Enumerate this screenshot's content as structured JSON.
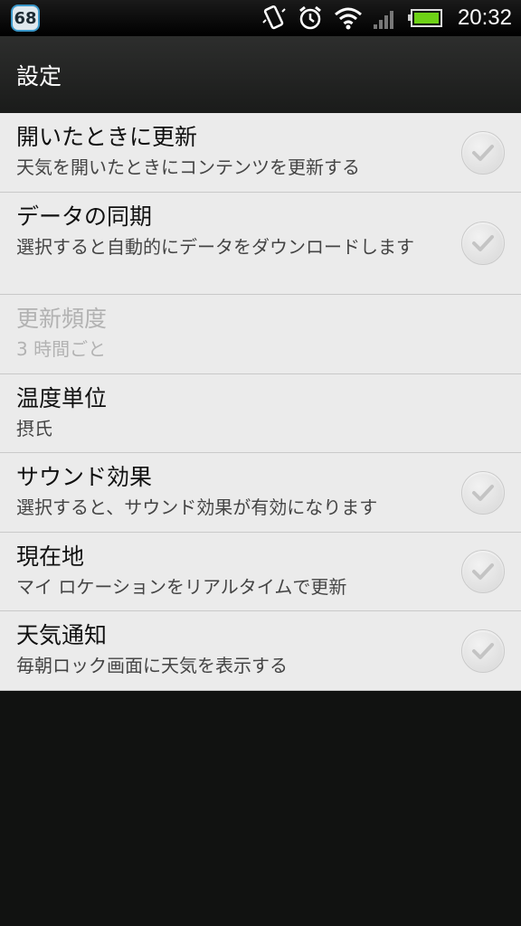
{
  "status_bar": {
    "notification_count": "68",
    "time": "20:32",
    "icons": [
      "vibrate-icon",
      "alarm-icon",
      "wifi-icon",
      "signal-icon",
      "battery-icon"
    ]
  },
  "header": {
    "title": "設定"
  },
  "settings": [
    {
      "title": "開いたときに更新",
      "summary": "天気を開いたときにコンテンツを更新する",
      "checkbox": true,
      "enabled": true
    },
    {
      "title": "データの同期",
      "summary": "選択すると自動的にデータをダウンロードします",
      "checkbox": true,
      "enabled": true
    },
    {
      "title": "更新頻度",
      "summary": "3 時間ごと",
      "checkbox": false,
      "enabled": false
    },
    {
      "title": "温度単位",
      "summary": "摂氏",
      "checkbox": false,
      "enabled": true
    },
    {
      "title": "サウンド効果",
      "summary": "選択すると、サウンド効果が有効になります",
      "checkbox": true,
      "enabled": true
    },
    {
      "title": "現在地",
      "summary": "マイ ロケーションをリアルタイムで更新",
      "checkbox": true,
      "enabled": true
    },
    {
      "title": "天気通知",
      "summary": "毎朝ロック画面に天気を表示する",
      "checkbox": true,
      "enabled": true
    }
  ]
}
